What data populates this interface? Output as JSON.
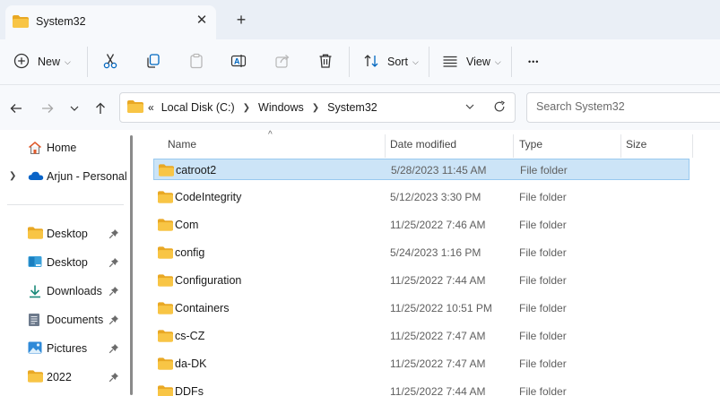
{
  "tab": {
    "title": "System32",
    "close_glyph": "✕",
    "new_glyph": "+"
  },
  "toolbar": {
    "new_label": "New",
    "sort_label": "Sort",
    "view_label": "View",
    "more_glyph": "•••"
  },
  "address": {
    "overflow_glyph": "«",
    "breadcrumbs": [
      "Local Disk (C:)",
      "Windows",
      "System32"
    ]
  },
  "search": {
    "placeholder": "Search System32"
  },
  "sidebar": {
    "items": [
      {
        "label": "Home",
        "icon": "home-icon"
      },
      {
        "label": "Arjun - Personal",
        "icon": "onedrive-icon"
      },
      {
        "label": "Desktop",
        "icon": "folder-icon",
        "pinned": true
      },
      {
        "label": "Desktop",
        "icon": "desktop-icon",
        "pinned": true
      },
      {
        "label": "Downloads",
        "icon": "download-icon",
        "pinned": true
      },
      {
        "label": "Documents",
        "icon": "documents-icon",
        "pinned": true
      },
      {
        "label": "Pictures",
        "icon": "pictures-icon",
        "pinned": true
      },
      {
        "label": "2022",
        "icon": "folder-icon",
        "pinned": true
      }
    ]
  },
  "columns": {
    "name": "Name",
    "date": "Date modified",
    "type": "Type",
    "size": "Size"
  },
  "files": [
    {
      "name": "catroot2",
      "date": "5/28/2023 11:45 AM",
      "type": "File folder",
      "size": "",
      "selected": true
    },
    {
      "name": "CodeIntegrity",
      "date": "5/12/2023 3:30 PM",
      "type": "File folder",
      "size": ""
    },
    {
      "name": "Com",
      "date": "11/25/2022 7:46 AM",
      "type": "File folder",
      "size": ""
    },
    {
      "name": "config",
      "date": "5/24/2023 1:16 PM",
      "type": "File folder",
      "size": ""
    },
    {
      "name": "Configuration",
      "date": "11/25/2022 7:44 AM",
      "type": "File folder",
      "size": ""
    },
    {
      "name": "Containers",
      "date": "11/25/2022 10:51 PM",
      "type": "File folder",
      "size": ""
    },
    {
      "name": "cs-CZ",
      "date": "11/25/2022 7:47 AM",
      "type": "File folder",
      "size": ""
    },
    {
      "name": "da-DK",
      "date": "11/25/2022 7:47 AM",
      "type": "File folder",
      "size": ""
    },
    {
      "name": "DDFs",
      "date": "11/25/2022 7:44 AM",
      "type": "File folder",
      "size": ""
    }
  ],
  "colors": {
    "folder": "#f8c545",
    "folder_dark": "#e9a824",
    "accent": "#0067c0",
    "selection": "#cce4f7"
  }
}
